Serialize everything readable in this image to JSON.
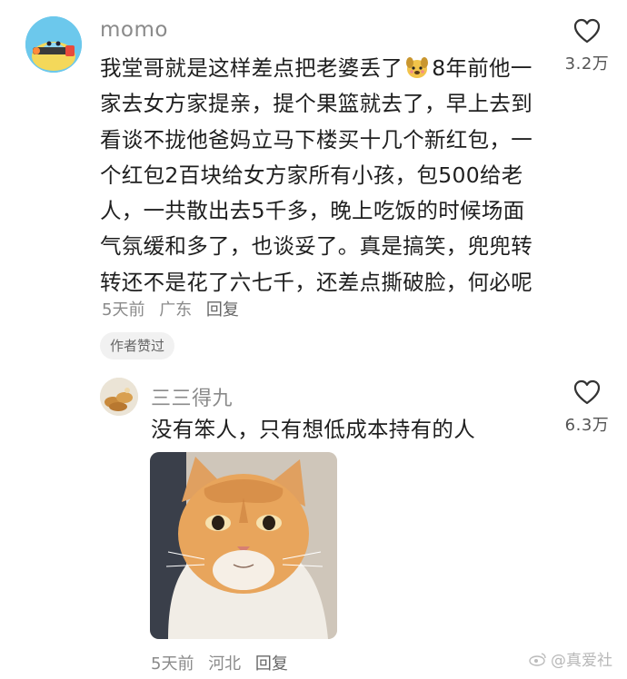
{
  "comments": [
    {
      "username": "momo",
      "text_before_emoji": "我堂哥就是这样差点把老婆丢了",
      "text_after_emoji": "8年前他一家去女方家提亲，提个果篮就去了，早上去到看谈不拢他爸妈立马下楼买十几个新红包，一个红包2百块给女方家所有小孩，包500给老人，一共散出去5千多，晚上吃饭的时候场面气氛缓和多了，也谈妥了。真是搞笑，兜兜转转还不是花了六七千，还差点撕破脸，何必呢",
      "time": "5天前",
      "location": "广东",
      "reply_label": "回复",
      "author_badge": "作者赞过",
      "like_count": "3.2万"
    },
    {
      "username": "三三得九",
      "text": "没有笨人，只有想低成本持有的人",
      "time": "5天前",
      "location": "河北",
      "reply_label": "回复",
      "like_count": "6.3万"
    }
  ],
  "watermark": "@真爱社",
  "colors": {
    "meta_gray": "#8a8a8a",
    "badge_bg": "#f1f1f1",
    "avatar1_bg": "#6cc8ec"
  }
}
